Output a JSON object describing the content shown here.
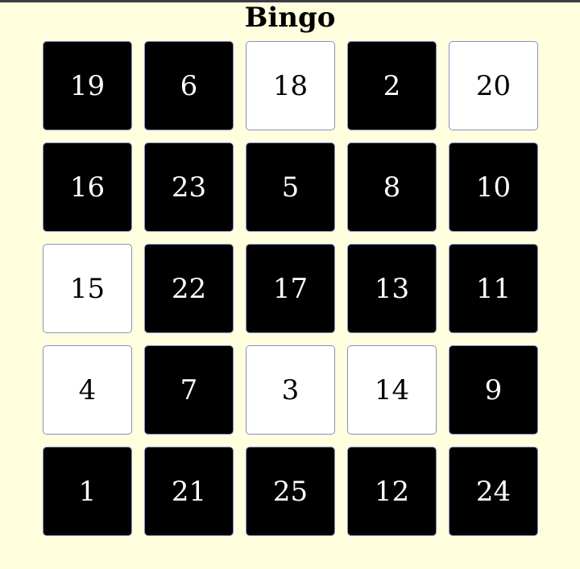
{
  "title": "Bingo",
  "colors": {
    "background": "#ffffe0",
    "marked_fill": "#000000",
    "marked_text": "#ffffff",
    "unmarked_fill": "#ffffff",
    "unmarked_text": "#000000",
    "cell_border": "#8a8fbf"
  },
  "board": {
    "rows": [
      [
        {
          "number": "19",
          "marked": true
        },
        {
          "number": "6",
          "marked": true
        },
        {
          "number": "18",
          "marked": false
        },
        {
          "number": "2",
          "marked": true
        },
        {
          "number": "20",
          "marked": false
        }
      ],
      [
        {
          "number": "16",
          "marked": true
        },
        {
          "number": "23",
          "marked": true
        },
        {
          "number": "5",
          "marked": true
        },
        {
          "number": "8",
          "marked": true
        },
        {
          "number": "10",
          "marked": true
        }
      ],
      [
        {
          "number": "15",
          "marked": false
        },
        {
          "number": "22",
          "marked": true
        },
        {
          "number": "17",
          "marked": true
        },
        {
          "number": "13",
          "marked": true
        },
        {
          "number": "11",
          "marked": true
        }
      ],
      [
        {
          "number": "4",
          "marked": false
        },
        {
          "number": "7",
          "marked": true
        },
        {
          "number": "3",
          "marked": false
        },
        {
          "number": "14",
          "marked": false
        },
        {
          "number": "9",
          "marked": true
        }
      ],
      [
        {
          "number": "1",
          "marked": true
        },
        {
          "number": "21",
          "marked": true
        },
        {
          "number": "25",
          "marked": true
        },
        {
          "number": "12",
          "marked": true
        },
        {
          "number": "24",
          "marked": true
        }
      ]
    ]
  }
}
